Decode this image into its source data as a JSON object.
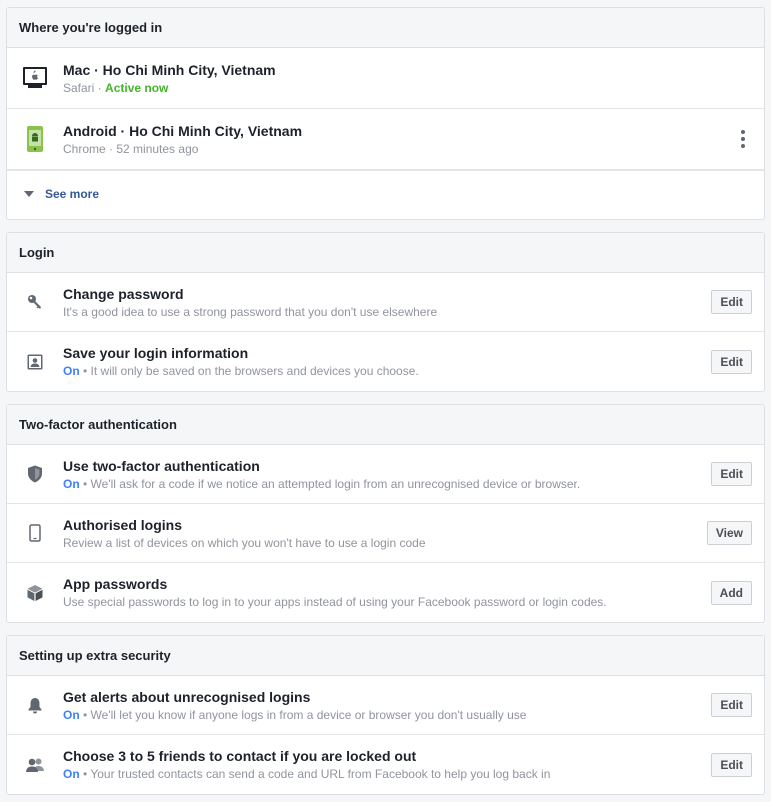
{
  "sessions": {
    "header": "Where you're logged in",
    "devices": [
      {
        "title": "Mac · Ho Chi Minh City, Vietnam",
        "browser": "Safari",
        "status": "Active now",
        "icon": "mac-icon"
      },
      {
        "title": "Android · Ho Chi Minh City, Vietnam",
        "browser": "Chrome",
        "status": "52 minutes ago",
        "icon": "android-icon"
      }
    ],
    "see_more": "See more",
    "separator": " · "
  },
  "login": {
    "header": "Login",
    "items": [
      {
        "title": "Change password",
        "sub": "It's a good idea to use a strong password that you don't use elsewhere",
        "on": "",
        "button": "Edit",
        "icon": "key-icon"
      },
      {
        "title": "Save your login information",
        "on": "On",
        "sub": "It will only be saved on the browsers and devices you choose.",
        "button": "Edit",
        "icon": "login-info-icon"
      }
    ]
  },
  "two_factor": {
    "header": "Two-factor authentication",
    "items": [
      {
        "title": "Use two-factor authentication",
        "on": "On",
        "sub": "We'll ask for a code if we notice an attempted login from an unrecognised device or browser.",
        "button": "Edit",
        "icon": "shield-icon"
      },
      {
        "title": "Authorised logins",
        "on": "",
        "sub": "Review a list of devices on which you won't have to use a login code",
        "button": "View",
        "icon": "phone-icon"
      },
      {
        "title": "App passwords",
        "on": "",
        "sub": "Use special passwords to log in to your apps instead of using your Facebook password or login codes.",
        "button": "Add",
        "icon": "box-icon"
      }
    ]
  },
  "extra": {
    "header": "Setting up extra security",
    "items": [
      {
        "title": "Get alerts about unrecognised logins",
        "on": "On",
        "sub": "We'll let you know if anyone logs in from a device or browser you don't usually use",
        "button": "Edit",
        "icon": "bell-icon"
      },
      {
        "title": "Choose 3 to 5 friends to contact if you are locked out",
        "on": "On",
        "sub": "Your trusted contacts can send a code and URL from Facebook to help you log back in",
        "button": "Edit",
        "icon": "friends-icon"
      }
    ]
  },
  "bullet": " • ",
  "colors": {
    "link": "#365899",
    "on": "#4080ff",
    "active": "#42b72a",
    "icon": "#606770"
  }
}
